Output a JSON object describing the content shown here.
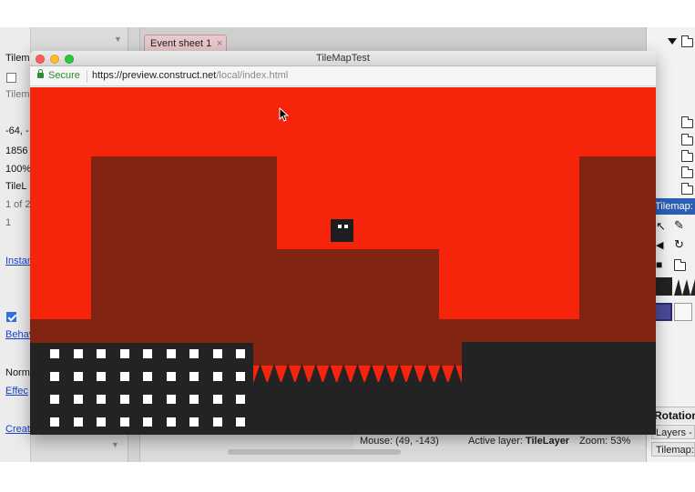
{
  "ide": {
    "left_panel_rows": [
      "Tilem",
      "Tilem",
      "-64, -",
      "1856",
      "100%",
      "TileL",
      "1 of 2",
      "1",
      "Instan",
      "Behav",
      "Norm",
      "Effec",
      "Creat"
    ],
    "event_tab": {
      "label": "Event sheet 1",
      "close_glyph": "×"
    },
    "right_panel": {
      "tilemap_header": "Tilemap: T",
      "rotation_label": "Rotation",
      "layers_tab": "Layers -",
      "tilemap_tab": "Tilemap:"
    },
    "status": {
      "mouse": "Mouse: (49, -143)",
      "active_layer_prefix": "Active layer:",
      "active_layer_name": "TileLayer",
      "zoom": "Zoom: 53%"
    }
  },
  "browser": {
    "window_title": "TileMapTest",
    "secure_label": "Secure",
    "url_host": "https://preview.construct.net",
    "url_path": "/local/index.html"
  },
  "colors": {
    "sky_red": "#f5240a",
    "wall_brown": "#812412",
    "ground_dark": "#232323",
    "tile_white": "#ffffff"
  },
  "icons": [
    "lock-icon",
    "folder-icon",
    "pointer-tool-icon",
    "pencil-tool-icon",
    "rotate-tool-icon",
    "save-icon",
    "open-folder-icon",
    "mouse-cursor-icon"
  ]
}
